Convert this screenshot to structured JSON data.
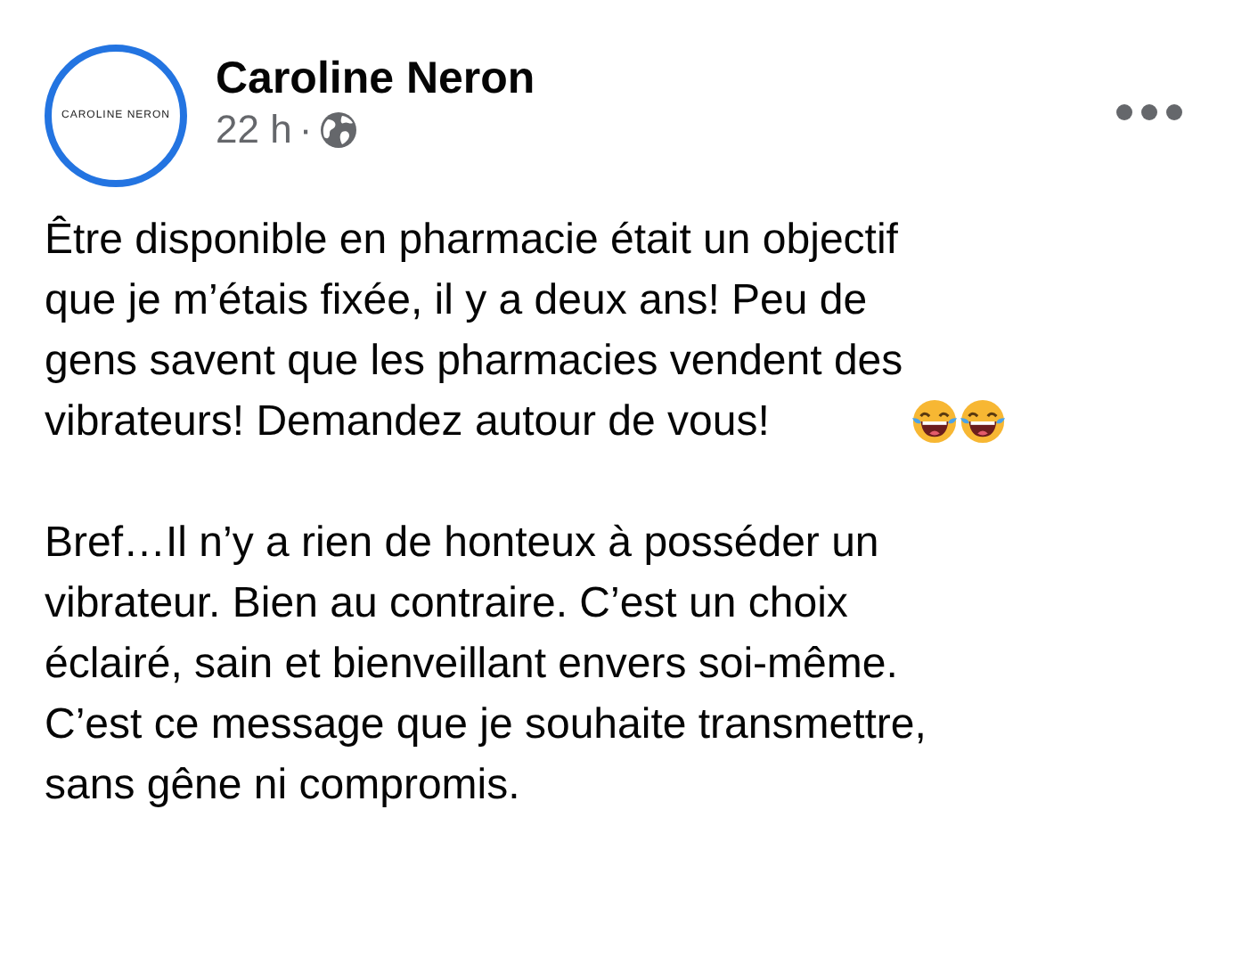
{
  "post": {
    "author": "Caroline Neron",
    "avatar_text": "CAROLINE NERON",
    "time": "22 h",
    "separator": "·",
    "paragraphs": [
      {
        "lines": [
          "Être disponible en pharmacie était un objectif",
          "que je m’étais fixée, il y a deux ans! Peu de",
          "gens savent que les pharmacies vendent des",
          "vibrateurs! Demandez autour de vous!"
        ],
        "emojis": [
          {
            "kind": "laughing"
          },
          {
            "kind": "laughing"
          }
        ]
      },
      {
        "lines": [
          "Bref…Il n’y a rien de honteux à posséder un",
          "vibrateur. Bien au contraire. C’est un choix",
          "éclairé, sain et bienveillant envers soi-même.",
          "C’est ce message que je souhaite transmettre,",
          "sans gêne ni compromis."
        ]
      }
    ]
  }
}
